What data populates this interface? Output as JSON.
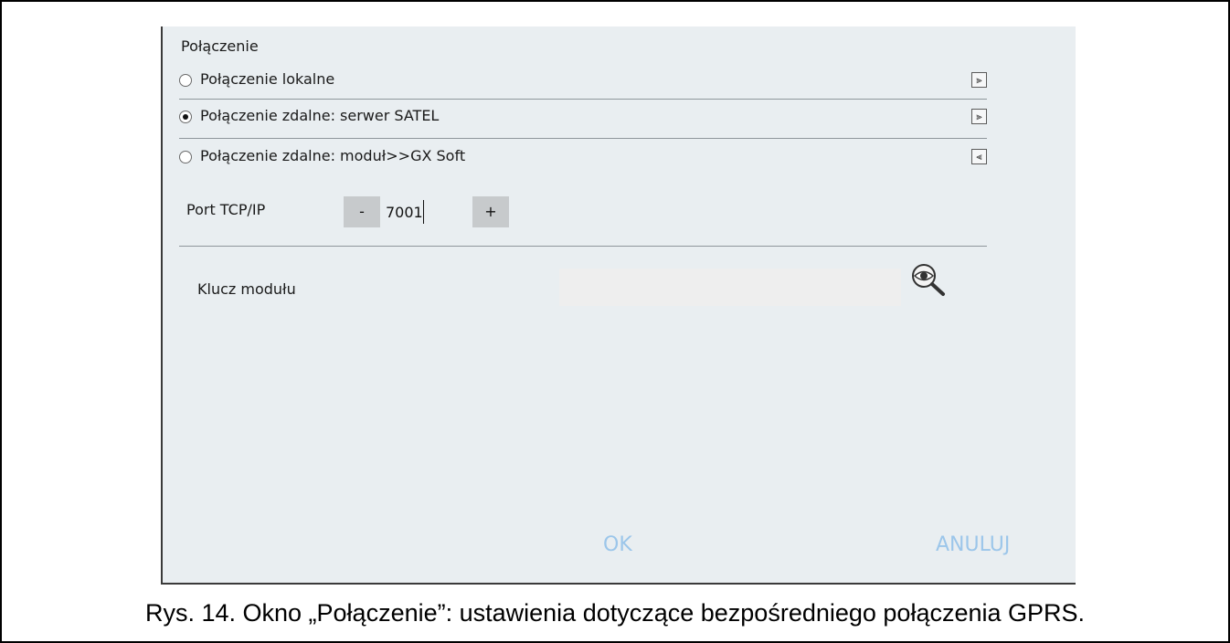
{
  "dialog": {
    "section_title": "Połączenie",
    "options": [
      {
        "label": "Połączenie lokalne",
        "selected": false,
        "chevron": "double-chevron-down-icon"
      },
      {
        "label": "Połączenie zdalne: serwer SATEL",
        "selected": true,
        "chevron": "double-chevron-down-icon"
      },
      {
        "label": "Połączenie zdalne: moduł>>GX Soft",
        "selected": false,
        "chevron": "double-chevron-up-icon"
      }
    ],
    "port": {
      "label": "Port TCP/IP",
      "minus": "-",
      "value": "7001",
      "plus": "+"
    },
    "key": {
      "label": "Klucz modułu",
      "value": "",
      "reveal_icon": "magnifier-eye-icon"
    },
    "buttons": {
      "ok": "OK",
      "cancel": "ANULUJ"
    },
    "colors": {
      "background": "#e9eef1",
      "button_text": "#9cc6ea",
      "stepper_button": "#c7cacc"
    }
  },
  "caption": "Rys. 14. Okno „Połączenie”: ustawienia dotyczące bezpośredniego połączenia GPRS."
}
